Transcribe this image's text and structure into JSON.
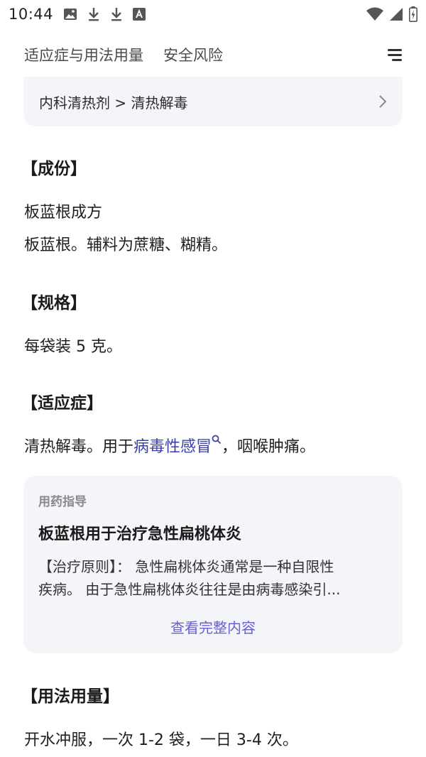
{
  "status_bar": {
    "time": "10:44",
    "left_icons": [
      "image-icon",
      "download-icon",
      "download-icon",
      "font-app-icon"
    ],
    "right_icons": [
      "wifi-icon",
      "cell-signal-icon",
      "battery-icon"
    ]
  },
  "nav": {
    "tabs": [
      "适应症与用法用量",
      "安全风险"
    ],
    "menu_icon": "menu-lines-icon"
  },
  "category": {
    "text": "内科清热剂 > 清热解毒"
  },
  "sections": {
    "ingredients": {
      "heading": "【成份】",
      "line1": "板蓝根成方",
      "line2": "板蓝根。辅料为蔗糖、糊精。"
    },
    "specification": {
      "heading": "【规格】",
      "line1": "每袋装 5 克。"
    },
    "indications": {
      "heading": "【适应症】",
      "text_before": "清热解毒。用于",
      "link": "病毒性感冒",
      "text_after": "，咽喉肿痛。"
    },
    "dosage": {
      "heading": "【用法用量】",
      "line1": "开水冲服，一次 1-2 袋，一日 3-4 次。"
    }
  },
  "guide": {
    "label": "用药指导",
    "title": "板蓝根用于治疗急性扁桃体炎",
    "desc_line1": "【治疗原则】：  急性扁桃体炎通常是一种自限性",
    "desc_line2": "疾病。 由于急性扁桃体炎往往是由病毒感染引...",
    "more": "查看完整内容"
  },
  "colors": {
    "card_bg": "#f4f5f9",
    "link": "#3b3fa8",
    "more_link": "#6b5fd0"
  }
}
